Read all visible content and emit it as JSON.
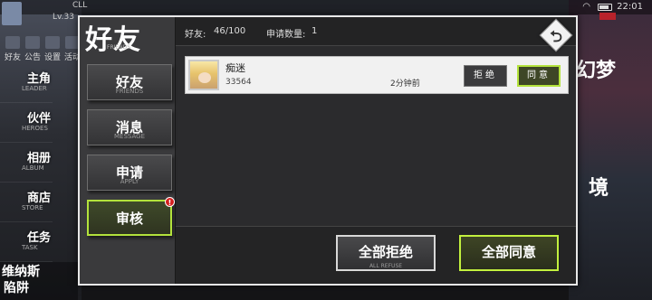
{
  "status_bar": {
    "time": "22:01",
    "wifi_icon": "wifi-icon",
    "battery_icon": "battery-icon"
  },
  "hud": {
    "player_name": "CLL",
    "player_level": "Lv.33",
    "icon_labels": [
      "好友",
      "公告",
      "设置",
      "活动"
    ]
  },
  "background_menu": {
    "items": [
      {
        "cn": "主角",
        "en": "LEADER"
      },
      {
        "cn": "伙伴",
        "en": "HEROES"
      },
      {
        "cn": "相册",
        "en": "ALBUM"
      },
      {
        "cn": "商店",
        "en": "STORE"
      },
      {
        "cn": "任务",
        "en": "TASK"
      }
    ],
    "bottom_text_1": "维纳斯",
    "bottom_text_2": "陷阱"
  },
  "right_deco": {
    "text_1": "幻梦",
    "text_2": "境"
  },
  "modal": {
    "title": "好友",
    "title_en": "FRIENDS",
    "tabs": [
      {
        "label": "好友",
        "label_en": "FRIENDS"
      },
      {
        "label": "消息",
        "label_en": "MESSAGE"
      },
      {
        "label": "申请",
        "label_en": "APPLY"
      },
      {
        "label": "审核",
        "label_en": ""
      }
    ],
    "active_tab_badge": "!",
    "stats": {
      "friends_label": "好友:",
      "friends_value": "46/100",
      "requests_label": "申请数量:",
      "requests_value": "1"
    },
    "back_glyph": "⮌",
    "requests": [
      {
        "name": "痴迷",
        "id": "33564",
        "time": "2分钟前",
        "reject_label": "拒绝",
        "accept_label": "同意"
      }
    ],
    "footer": {
      "reject_all_label": "全部拒绝",
      "reject_all_en": "ALL REFUSE",
      "accept_all_label": "全部同意",
      "accept_all_en": ""
    }
  },
  "colors": {
    "accent_green": "#b3e23c",
    "badge_red": "#d42020",
    "modal_border": "#e8e8e8"
  }
}
